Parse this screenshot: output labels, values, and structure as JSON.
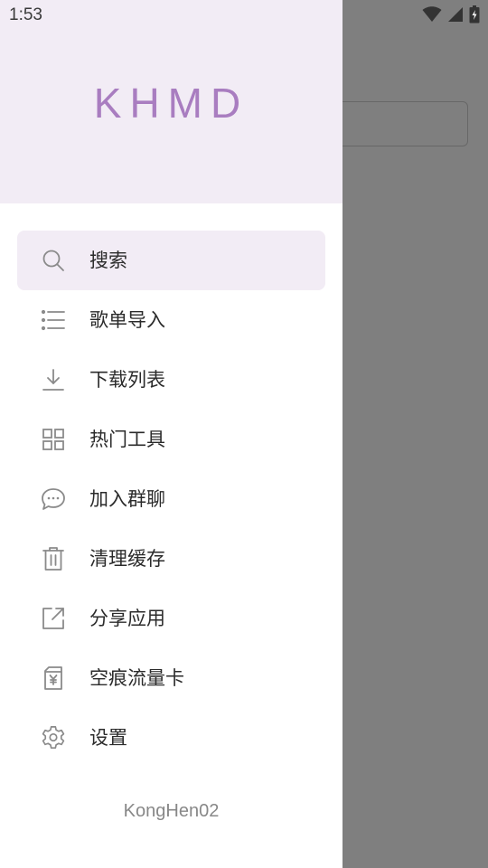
{
  "status_bar": {
    "time": "1:53",
    "icons": [
      "wifi-icon",
      "cellular-signal-icon",
      "battery-charging-icon"
    ]
  },
  "drawer": {
    "brand": "KHMD",
    "footer": "KongHen02",
    "items": [
      {
        "label": "搜索",
        "icon": "search-icon",
        "active": true
      },
      {
        "label": "歌单导入",
        "icon": "list-icon"
      },
      {
        "label": "下载列表",
        "icon": "download-icon"
      },
      {
        "label": "热门工具",
        "icon": "grid-icon"
      },
      {
        "label": "加入群聊",
        "icon": "chat-icon"
      },
      {
        "label": "清理缓存",
        "icon": "trash-icon"
      },
      {
        "label": "分享应用",
        "icon": "share-icon"
      },
      {
        "label": "空痕流量卡",
        "icon": "sim-card-icon"
      },
      {
        "label": "设置",
        "icon": "gear-icon"
      }
    ]
  },
  "colors": {
    "accent": "#a97dc0",
    "header_bg": "#f2ecf5",
    "icon": "#8a8a8a",
    "scrim": "#808080"
  }
}
